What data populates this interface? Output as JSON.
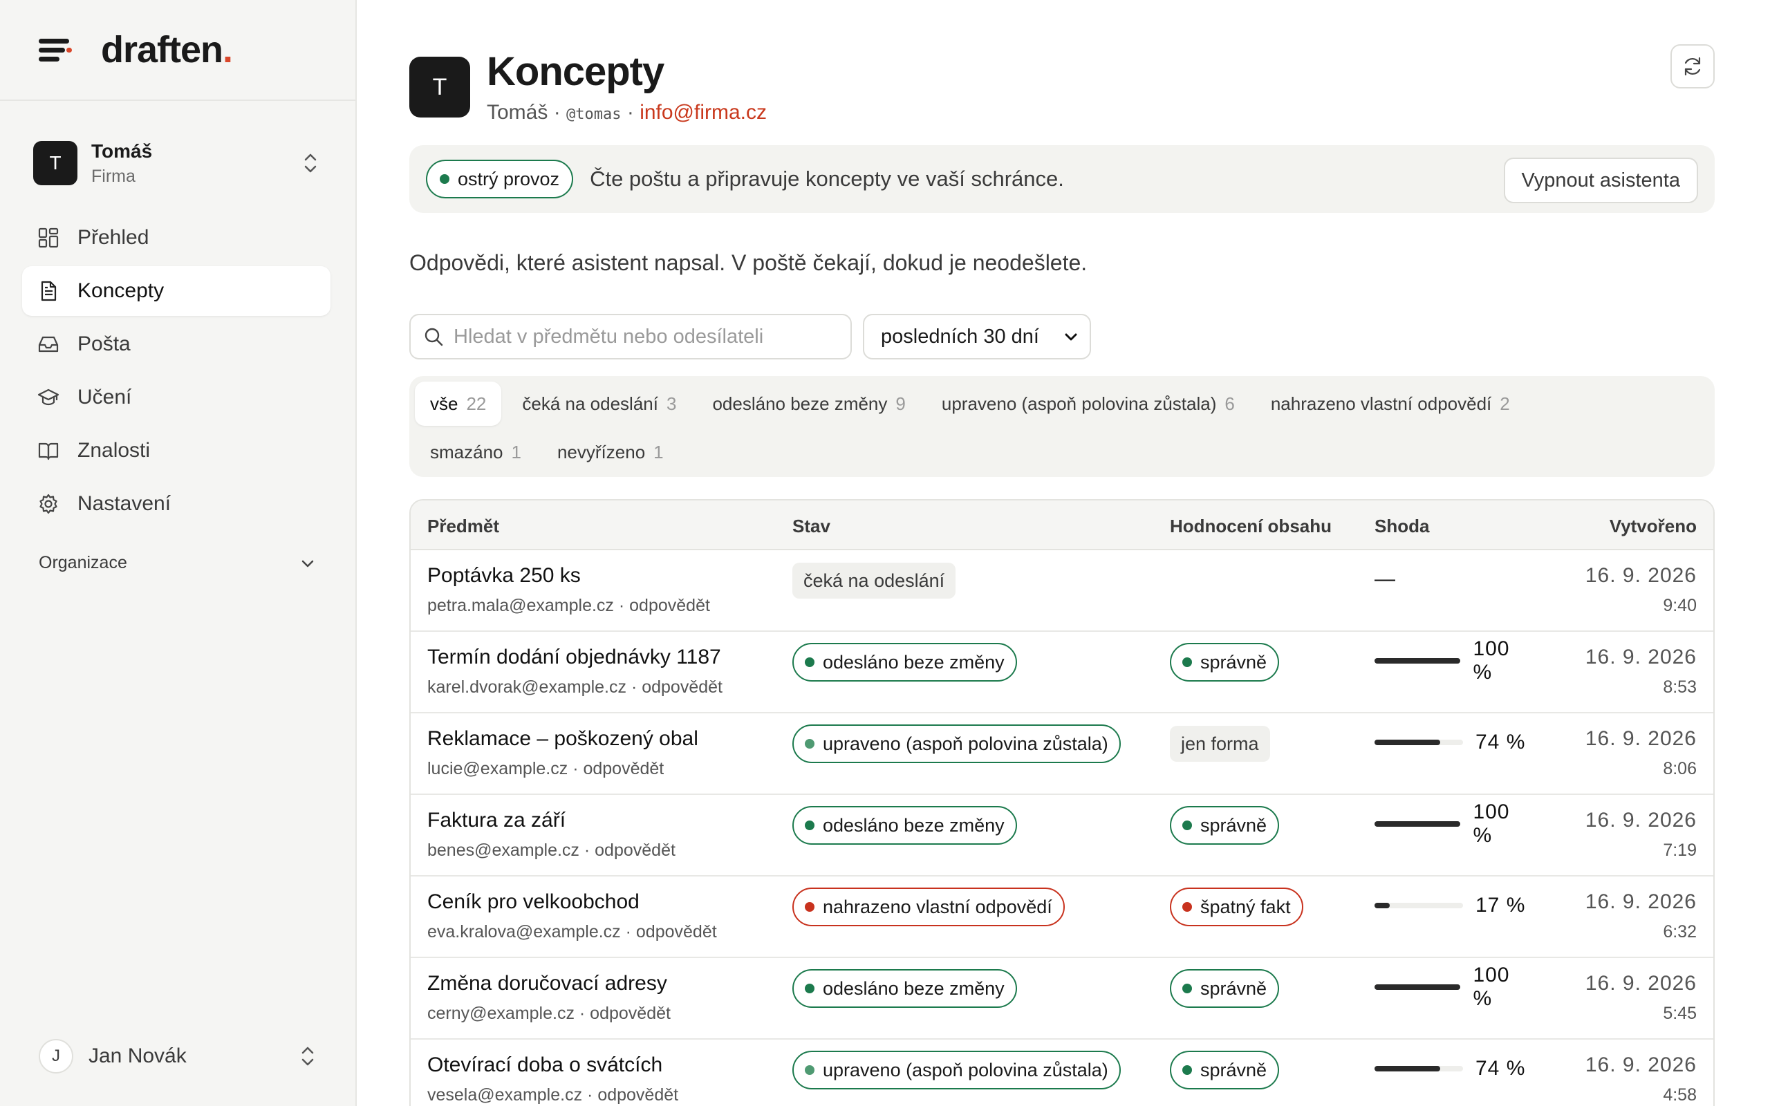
{
  "brand": {
    "name": "draften",
    "dot": "."
  },
  "workspace": {
    "initial": "T",
    "name": "Tomáš",
    "org": "Firma"
  },
  "nav": [
    {
      "label": "Přehled",
      "icon": "grid-icon",
      "active": false
    },
    {
      "label": "Koncepty",
      "icon": "document-icon",
      "active": true
    },
    {
      "label": "Pošta",
      "icon": "inbox-icon",
      "active": false
    },
    {
      "label": "Učení",
      "icon": "graduation-cap-icon",
      "active": false
    },
    {
      "label": "Znalosti",
      "icon": "book-icon",
      "active": false
    },
    {
      "label": "Nastavení",
      "icon": "gear-icon",
      "active": false
    }
  ],
  "org_section": {
    "label": "Organizace"
  },
  "user": {
    "initial": "J",
    "name": "Jan Novák"
  },
  "header": {
    "initial": "T",
    "title": "Koncepty",
    "name": "Tomáš",
    "sep1": " · ",
    "handle": "@tomas",
    "sep2": " · ",
    "email": "info@firma.cz"
  },
  "status": {
    "pill": "ostrý provoz",
    "text": "Čte poštu a připravuje koncepty ve vaší schránce.",
    "button": "Vypnout asistenta"
  },
  "intro": "Odpovědi, které asistent napsal. V poště čekají, dokud je neodešlete.",
  "search": {
    "placeholder": "Hledat v předmětu nebo odesílateli",
    "value": ""
  },
  "range": {
    "selected": "posledních 30 dní"
  },
  "filters": [
    {
      "label": "vše",
      "count": "22",
      "active": true
    },
    {
      "label": "čeká na odeslání",
      "count": "3",
      "active": false
    },
    {
      "label": "odesláno beze změny",
      "count": "9",
      "active": false
    },
    {
      "label": "upraveno (aspoň polovina zůstala)",
      "count": "6",
      "active": false
    },
    {
      "label": "nahrazeno vlastní odpovědí",
      "count": "2",
      "active": false
    },
    {
      "label": "smazáno",
      "count": "1",
      "active": false
    },
    {
      "label": "nevyřízeno",
      "count": "1",
      "active": false
    }
  ],
  "table": {
    "headers": {
      "subject": "Předmět",
      "status": "Stav",
      "rating": "Hodnocení obsahu",
      "match": "Shoda",
      "created": "Vytvořeno"
    },
    "rows": [
      {
        "subject": "Poptávka 250 ks",
        "sender": "petra.mala@example.cz",
        "reply": "odpovědět",
        "status": "čeká na odeslání",
        "status_kind": "plain",
        "rating": "",
        "rating_kind": "none",
        "match": null,
        "match_text": "—",
        "date": "16. 9. 2026",
        "time": "9:40"
      },
      {
        "subject": "Termín dodání objednávky 1187",
        "sender": "karel.dvorak@example.cz",
        "reply": "odpovědět",
        "status": "odesláno beze změny",
        "status_kind": "green",
        "rating": "správně",
        "rating_kind": "green",
        "match": 100,
        "match_text": "100 %",
        "date": "16. 9. 2026",
        "time": "8:53"
      },
      {
        "subject": "Reklamace – poškozený obal",
        "sender": "lucie@example.cz",
        "reply": "odpovědět",
        "status": "upraveno (aspoň polovina zůstala)",
        "status_kind": "green-light",
        "rating": "jen forma",
        "rating_kind": "plain",
        "match": 74,
        "match_text": "74 %",
        "date": "16. 9. 2026",
        "time": "8:06"
      },
      {
        "subject": "Faktura za září",
        "sender": "benes@example.cz",
        "reply": "odpovědět",
        "status": "odesláno beze změny",
        "status_kind": "green",
        "rating": "správně",
        "rating_kind": "green",
        "match": 100,
        "match_text": "100 %",
        "date": "16. 9. 2026",
        "time": "7:19"
      },
      {
        "subject": "Ceník pro velkoobchod",
        "sender": "eva.kralova@example.cz",
        "reply": "odpovědět",
        "status": "nahrazeno vlastní odpovědí",
        "status_kind": "red",
        "rating": "špatný fakt",
        "rating_kind": "red",
        "match": 17,
        "match_text": "17 %",
        "date": "16. 9. 2026",
        "time": "6:32"
      },
      {
        "subject": "Změna doručovací adresy",
        "sender": "cerny@example.cz",
        "reply": "odpovědět",
        "status": "odesláno beze změny",
        "status_kind": "green",
        "rating": "správně",
        "rating_kind": "green",
        "match": 100,
        "match_text": "100 %",
        "date": "16. 9. 2026",
        "time": "5:45"
      },
      {
        "subject": "Otevírací doba o svátcích",
        "sender": "vesela@example.cz",
        "reply": "odpovědět",
        "status": "upraveno (aspoň polovina zůstala)",
        "status_kind": "green-light",
        "rating": "správně",
        "rating_kind": "green",
        "match": 74,
        "match_text": "74 %",
        "date": "16. 9. 2026",
        "time": "4:58"
      }
    ]
  },
  "colors": {
    "accent": "#c9391d",
    "green": "#1c7a4d",
    "green_light": "#4f9a72",
    "red": "#c8321e"
  }
}
